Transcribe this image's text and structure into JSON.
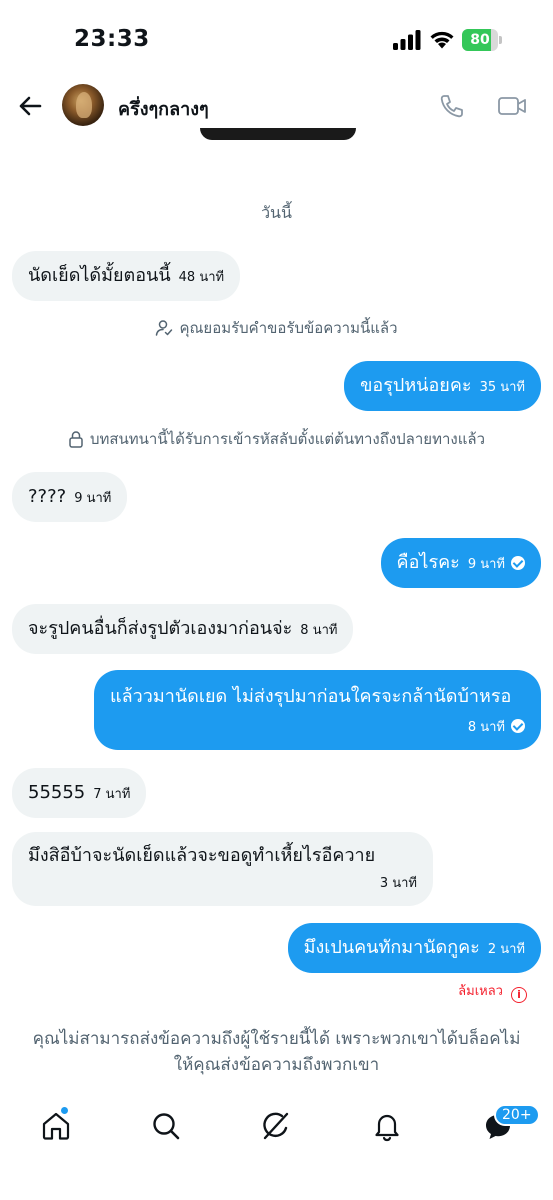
{
  "status_bar": {
    "time": "23:33",
    "battery": "80",
    "battery_level": 0.8
  },
  "header": {
    "name": "ครึ่งๆกลางๆ",
    "icons": [
      "back-arrow-icon",
      "phone-icon",
      "video-camera-icon"
    ]
  },
  "date_label": "วันนี้",
  "messages": [
    {
      "dir": "in",
      "text": "นัดเย็ดได้มั้ยตอนนี้",
      "time": "48 นาที"
    },
    {
      "dir": "out",
      "text": "ขอรุปหน่อยคะ",
      "time": "35 นาที"
    },
    {
      "dir": "in",
      "text": "????",
      "time": "9 นาที"
    },
    {
      "dir": "out",
      "text": "คือไรคะ",
      "time": "9 นาที",
      "seen": true
    },
    {
      "dir": "in",
      "text": "จะรูปคนอื่นก็ส่งรูปตัวเองมาก่อนจ่ะ",
      "time": "8 นาที"
    },
    {
      "dir": "out",
      "text": "แล้ววมานัดเยด ไม่ส่งรุปมาก่อนใครจะกล้านัดบ้าหรอ",
      "time": "8 นาที",
      "seen": true
    },
    {
      "dir": "in",
      "text": "55555",
      "time": "7 นาที"
    },
    {
      "dir": "in",
      "text": "มึงสิอีบ้าจะนัดเย็ดแล้วจะขอดูทำเหี้ยไรอีควาย",
      "time": "3 นาที"
    },
    {
      "dir": "out",
      "text": "มึงเปนคนทักมานัดกูคะ",
      "time": "2 นาที"
    }
  ],
  "system_notices": {
    "accepted": "คุณยอมรับคำขอรับข้อความนี้แล้ว",
    "encrypted": "บทสนทนานี้ได้รับการเข้ารหัสลับตั้งแต่ต้นทางถึงปลายทางแล้ว"
  },
  "failed_label": "ล้มเหลว",
  "blocked_notice": "คุณไม่สามารถส่งข้อความถึงผู้ใช้รายนี้ได้ เพราะพวกเขาได้บล็อคไม่ให้คุณส่งข้อความถึงพวกเขา",
  "nav": {
    "items": [
      "home-icon",
      "search-icon",
      "grok-icon",
      "bell-icon",
      "messages-icon"
    ],
    "messages_badge": "20+"
  },
  "colors": {
    "accent": "#1d9bf0",
    "incoming_bubble": "#eff3f4",
    "muted": "#536471",
    "error": "#f4212e"
  }
}
